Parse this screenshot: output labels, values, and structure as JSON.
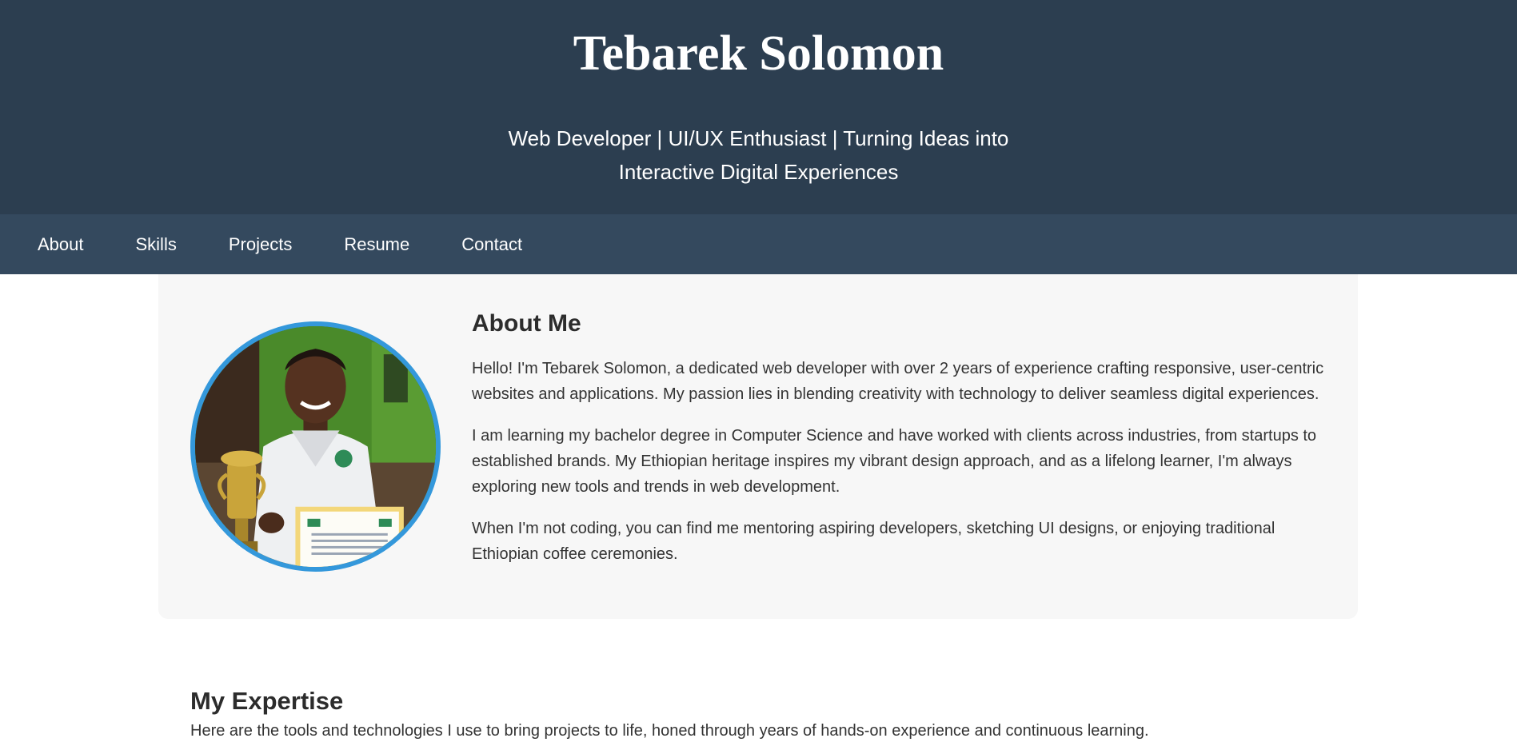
{
  "header": {
    "title": "Tebarek Solomon",
    "tagline": "Web Developer | UI/UX Enthusiast | Turning Ideas into Interactive Digital Experiences"
  },
  "nav": {
    "items": [
      {
        "label": "About"
      },
      {
        "label": "Skills"
      },
      {
        "label": "Projects"
      },
      {
        "label": "Resume"
      },
      {
        "label": "Contact"
      }
    ]
  },
  "about": {
    "heading": "About Me",
    "paragraphs": [
      "Hello! I'm Tebarek Solomon, a dedicated web developer with over 2 years of experience crafting responsive, user-centric websites and applications. My passion lies in blending creativity with technology to deliver seamless digital experiences.",
      "I am learning my bachelor degree in Computer Science and have worked with clients across industries, from startups to established brands. My Ethiopian heritage inspires my vibrant design approach, and as a lifelong learner, I'm always exploring new tools and trends in web development.",
      "When I'm not coding, you can find me mentoring aspiring developers, sketching UI designs, or enjoying traditional Ethiopian coffee ceremonies."
    ]
  },
  "expertise": {
    "heading": "My Expertise",
    "intro": "Here are the tools and technologies I use to bring projects to life, honed through years of hands-on experience and continuous learning."
  },
  "colors": {
    "header_bg": "#2c3e50",
    "nav_bg": "#34495e",
    "photo_border": "#3498db",
    "card_bg": "#f7f7f7"
  }
}
